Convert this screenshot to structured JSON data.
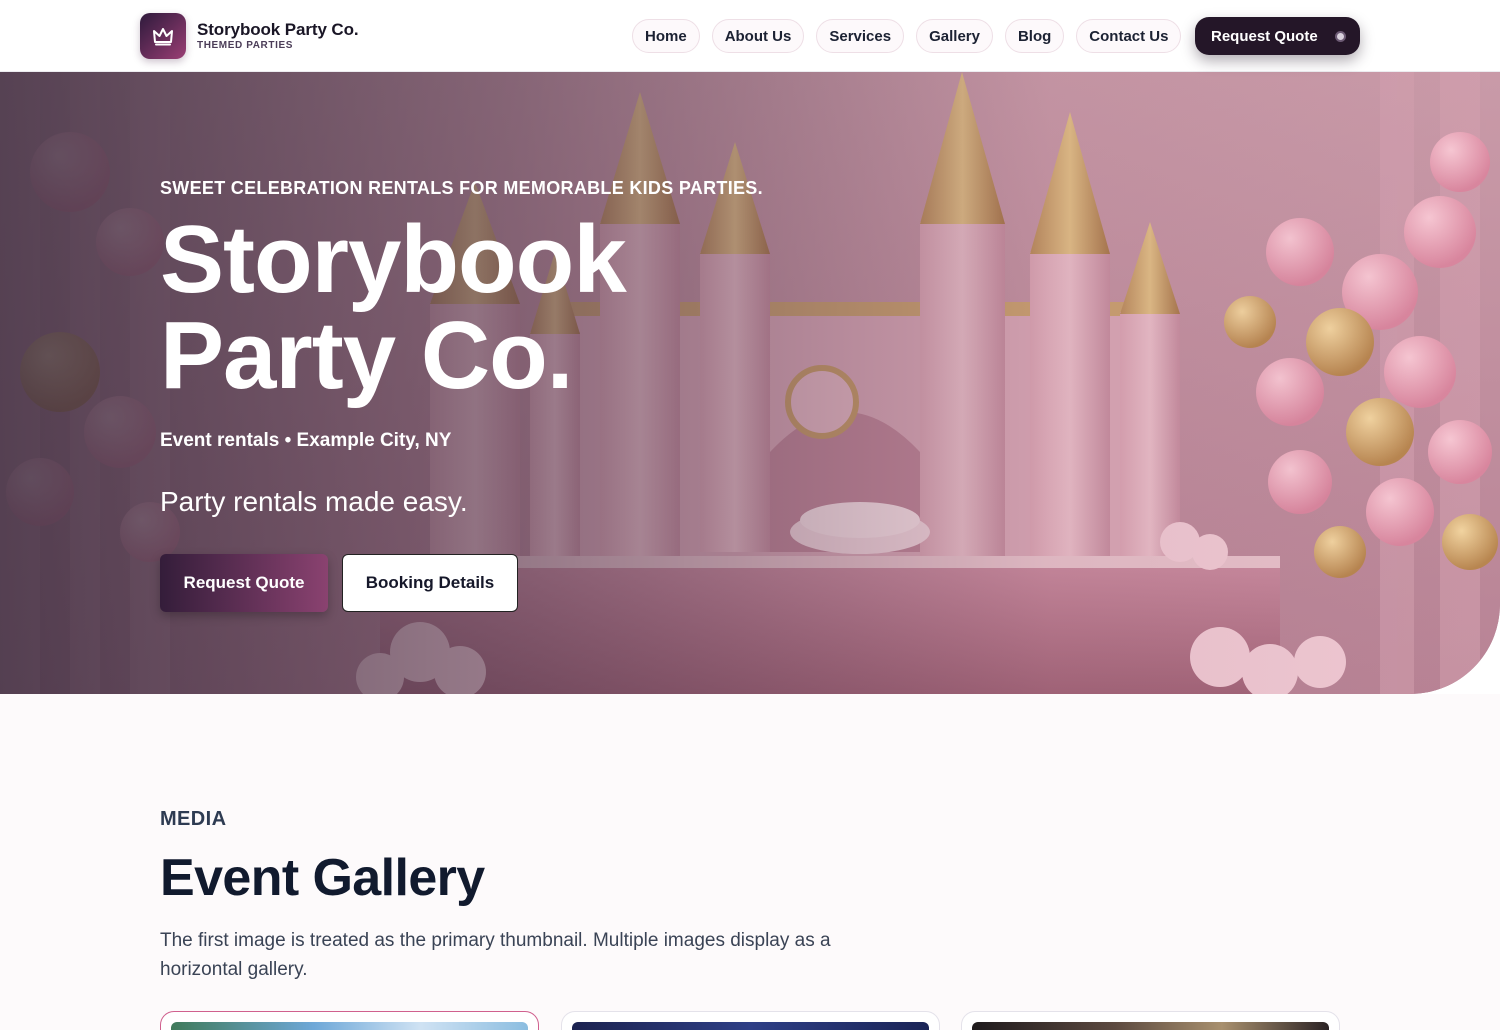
{
  "header": {
    "brand_name": "Storybook Party Co.",
    "brand_tag": "THEMED PARTIES",
    "nav": [
      {
        "label": "Home"
      },
      {
        "label": "About Us"
      },
      {
        "label": "Services"
      },
      {
        "label": "Gallery"
      },
      {
        "label": "Blog"
      },
      {
        "label": "Contact Us"
      }
    ],
    "cta_label": "Request Quote"
  },
  "hero": {
    "eyebrow": "SWEET CELEBRATION RENTALS FOR MEMORABLE KIDS PARTIES.",
    "title": "Storybook Party Co.",
    "meta": "Event rentals • Example City, NY",
    "description": "Party rentals made easy.",
    "primary_button": "Request Quote",
    "secondary_button": "Booking Details"
  },
  "gallery": {
    "eyebrow": "MEDIA",
    "title": "Event Gallery",
    "description": "The first image is treated as the primary thumbnail. Multiple images display as a horizontal gallery."
  },
  "colors": {
    "brand_dark": "#241628",
    "brand_accent": "#8a4270",
    "primary_card_border": "#d0608e"
  }
}
